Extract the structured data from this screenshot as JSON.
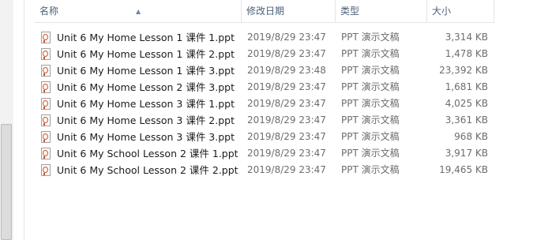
{
  "columns": {
    "name": "名称",
    "date": "修改日期",
    "type": "类型",
    "size": "大小"
  },
  "files": [
    {
      "name": "Unit 6 My Home Lesson 1 课件 1.ppt",
      "date": "2019/8/29 23:47",
      "type": "PPT 演示文稿",
      "size": "3,314 KB"
    },
    {
      "name": "Unit 6 My Home Lesson 1 课件 2.ppt",
      "date": "2019/8/29 23:47",
      "type": "PPT 演示文稿",
      "size": "1,478 KB"
    },
    {
      "name": "Unit 6 My Home Lesson 1 课件 3.ppt",
      "date": "2019/8/29 23:48",
      "type": "PPT 演示文稿",
      "size": "23,392 KB"
    },
    {
      "name": "Unit 6 My Home Lesson 2 课件 3.ppt",
      "date": "2019/8/29 23:47",
      "type": "PPT 演示文稿",
      "size": "1,681 KB"
    },
    {
      "name": "Unit 6 My Home Lesson 3 课件 1.ppt",
      "date": "2019/8/29 23:47",
      "type": "PPT 演示文稿",
      "size": "4,025 KB"
    },
    {
      "name": "Unit 6 My Home Lesson 3 课件 2.ppt",
      "date": "2019/8/29 23:47",
      "type": "PPT 演示文稿",
      "size": "3,361 KB"
    },
    {
      "name": "Unit 6 My Home Lesson 3 课件 3.ppt",
      "date": "2019/8/29 23:47",
      "type": "PPT 演示文稿",
      "size": "968 KB"
    },
    {
      "name": "Unit 6 My School Lesson 2 课件 1.ppt",
      "date": "2019/8/29 23:47",
      "type": "PPT 演示文稿",
      "size": "3,917 KB"
    },
    {
      "name": "Unit 6 My School Lesson 2 课件 2.ppt",
      "date": "2019/8/29 23:47",
      "type": "PPT 演示文稿",
      "size": "19,465 KB"
    }
  ],
  "icons": {
    "sort": "sort-ascending-icon",
    "file": "ppt-file-icon"
  }
}
